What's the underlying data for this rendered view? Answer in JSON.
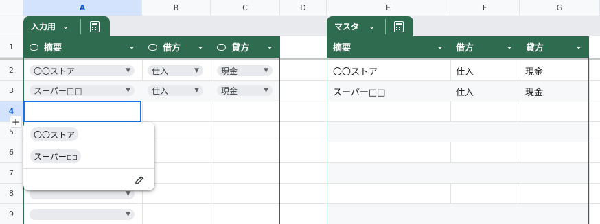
{
  "columns": [
    "A",
    "B",
    "C",
    "D",
    "E",
    "F",
    "G"
  ],
  "rows": [
    "1",
    "2",
    "3",
    "4",
    "5",
    "6",
    "7",
    "8",
    "9"
  ],
  "left_table": {
    "tab_label": "入力用",
    "headers": [
      "摘要",
      "借方",
      "貸方"
    ],
    "data": [
      [
        "〇〇ストア",
        "仕入",
        "現金"
      ],
      [
        "スーパー□□",
        "仕入",
        "現金"
      ]
    ]
  },
  "right_table": {
    "tab_label": "マスタ",
    "headers": [
      "摘要",
      "借方",
      "貸方"
    ],
    "data": [
      [
        "〇〇ストア",
        "仕入",
        "現金"
      ],
      [
        "スーパー□□",
        "仕入",
        "現金"
      ]
    ]
  },
  "dropdown": {
    "options": [
      "〇〇ストア",
      "スーパー▫▫"
    ]
  },
  "icons": {
    "chevron": "chevron-down-icon",
    "calc": "calculator-icon",
    "pill": "dropdown-chip-icon",
    "pencil": "pencil-icon",
    "plus": "plus-icon"
  },
  "colors": {
    "table_header": "#2f6b4f",
    "selection": "#1a73e8",
    "chip": "#e8eaed"
  }
}
